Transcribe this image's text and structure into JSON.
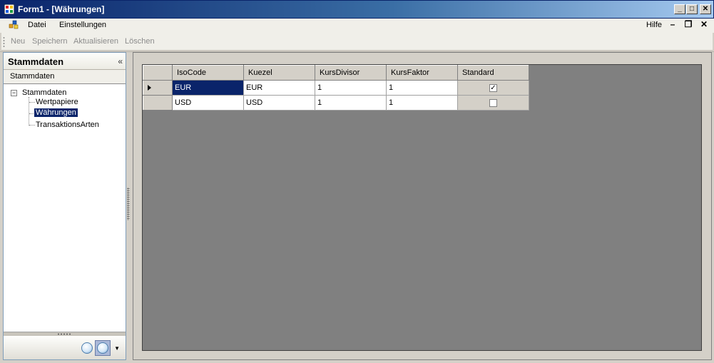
{
  "window": {
    "title": "Form1 - [Währungen]",
    "controls": {
      "minimize": "_",
      "maximize": "□",
      "close": "✕"
    }
  },
  "menu": {
    "items": [
      {
        "label": "Datei"
      },
      {
        "label": "Einstellungen"
      }
    ],
    "help": "Hilfe",
    "mdi_controls": {
      "minimize": "–",
      "restore": "❐",
      "close": "✕"
    }
  },
  "toolbar": {
    "buttons": [
      {
        "label": "Neu"
      },
      {
        "label": "Speichern"
      },
      {
        "label": "Aktualisieren"
      },
      {
        "label": "Löschen"
      }
    ]
  },
  "sidebar": {
    "title": "Stammdaten",
    "collapse_glyph": "«",
    "section_label": "Stammdaten",
    "tree": {
      "expander": "−",
      "root": "Stammdaten",
      "children": [
        {
          "label": "Wertpapiere",
          "selected": false
        },
        {
          "label": "Währungen",
          "selected": true
        },
        {
          "label": "TransaktionsArten",
          "selected": false
        }
      ]
    }
  },
  "grid": {
    "columns": [
      "IsoCode",
      "Kuezel",
      "KursDivisor",
      "KursFaktor",
      "Standard"
    ],
    "rows": [
      {
        "IsoCode": "EUR",
        "Kuezel": "EUR",
        "KursDivisor": "1",
        "KursFaktor": "1",
        "Standard": true,
        "current": true
      },
      {
        "IsoCode": "USD",
        "Kuezel": "USD",
        "KursDivisor": "1",
        "KursFaktor": "1",
        "Standard": false,
        "current": false
      }
    ],
    "check_glyph": "✓"
  },
  "colors": {
    "selection": "#0a246a",
    "window_bg": "#d4d0c8",
    "grid_bg": "#808080"
  }
}
